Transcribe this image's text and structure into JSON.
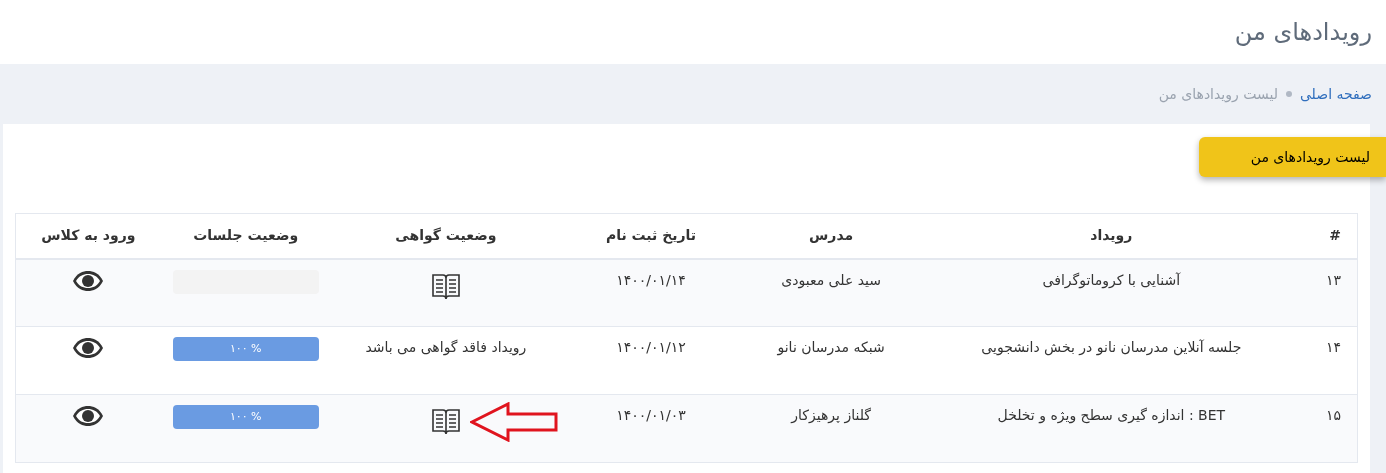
{
  "page_title": "رویدادهای من",
  "breadcrumb": [
    {
      "label": "صفحه اصلی",
      "kind": "link"
    },
    {
      "label": "لیست رویدادهای من",
      "kind": "current"
    }
  ],
  "card_tab": "لیست رویدادهای من",
  "table": {
    "columns": [
      "#",
      "رویداد",
      "مدرس",
      "تاریخ ثبت نام",
      "وضعیت گواهی",
      "وضعیت جلسات",
      "ورود به کلاس"
    ],
    "rows": [
      {
        "number": "۱۳",
        "event": "آشنایی با کروماتوگرافی",
        "teacher": "سید علی معبودی",
        "date": "۱۴۰۰/۰۱/۱۴",
        "certificate": {
          "kind": "icon"
        },
        "sessions": {
          "level": 0
        },
        "highlighted": false
      },
      {
        "number": "۱۴",
        "event": "جلسه آنلاین مدرسان نانو در بخش دانشجویی",
        "teacher": "شبکه مدرسان نانو",
        "date": "۱۴۰۰/۰۱/۱۲",
        "certificate": {
          "kind": "text",
          "text": "رویداد فاقد گواهی می باشد"
        },
        "sessions": {
          "level": 1,
          "reading": "% ۱۰۰"
        },
        "highlighted": false
      },
      {
        "number": "۱۵",
        "event": "BET : اندازه گیری سطح ویژه و تخلخل",
        "teacher": "گلناز پرهیزکار",
        "date": "۱۴۰۰/۰۱/۰۳",
        "certificate": {
          "kind": "icon"
        },
        "sessions": {
          "level": 1,
          "reading": "% ۱۰۰"
        },
        "highlighted": true
      }
    ]
  }
}
